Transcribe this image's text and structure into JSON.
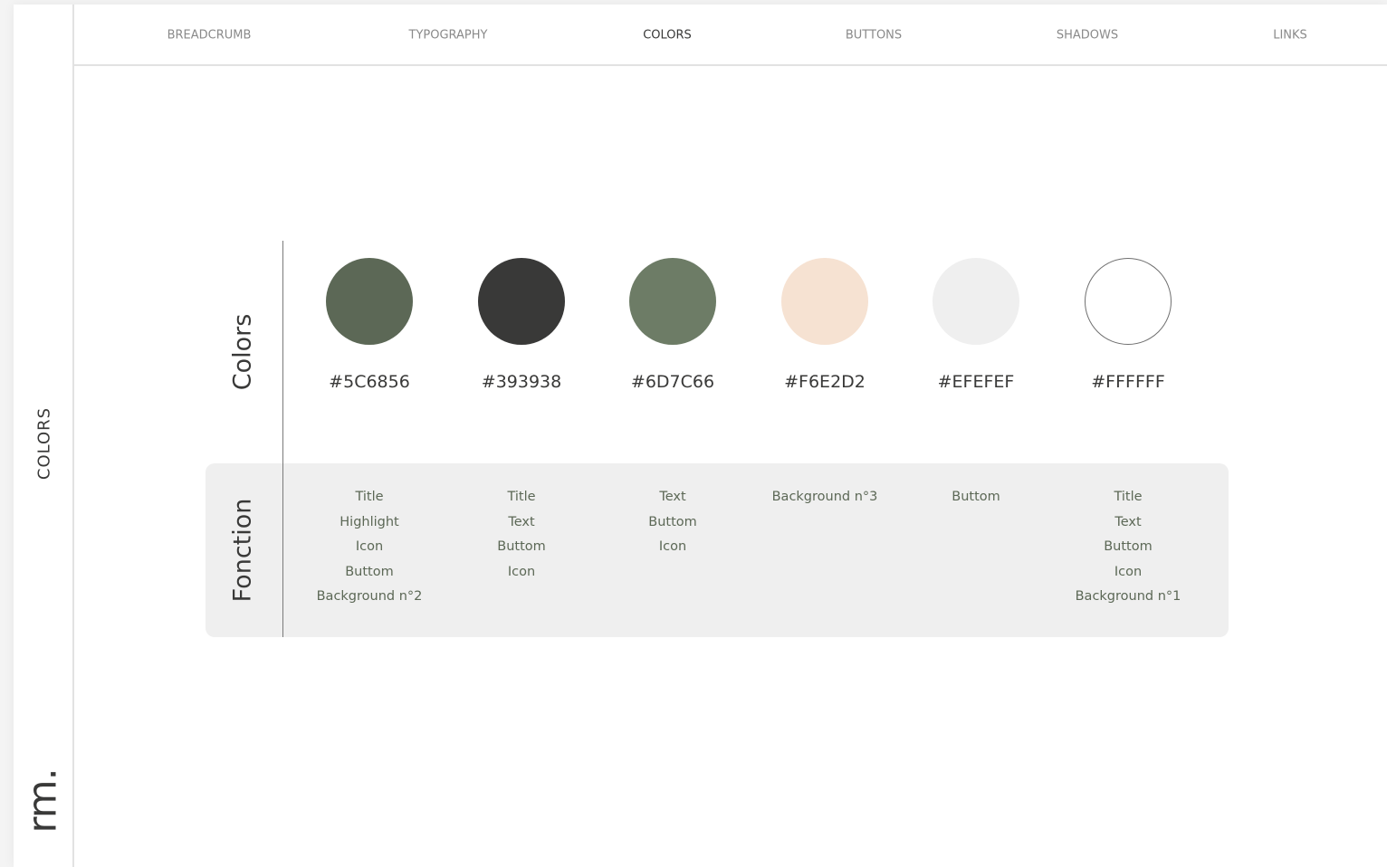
{
  "sidebar": {
    "section_label": "COLORS",
    "logo_text": "rm."
  },
  "nav": {
    "items": [
      {
        "label": "BREADCRUMB",
        "active": false
      },
      {
        "label": "TYPOGRAPHY",
        "active": false
      },
      {
        "label": "COLORS",
        "active": true
      },
      {
        "label": "BUTTONS",
        "active": false
      },
      {
        "label": "SHADOWS",
        "active": false
      },
      {
        "label": "LINKS",
        "active": false
      }
    ]
  },
  "colors_section": {
    "title": "Colors",
    "swatches": [
      {
        "hex": "#5C6856",
        "fill": "#5C6856"
      },
      {
        "hex": "#393938",
        "fill": "#393938"
      },
      {
        "hex": "#6D7C66",
        "fill": "#6D7C66"
      },
      {
        "hex": "#F6E2D2",
        "fill": "#F6E2D2"
      },
      {
        "hex": "#EFEFEF",
        "fill": "#EFEFEF"
      },
      {
        "hex": "#FFFFFF",
        "fill": "#FFFFFF"
      }
    ]
  },
  "function_section": {
    "title": "Fonction",
    "columns": [
      [
        "Title",
        "Highlight",
        "Icon",
        "Buttom",
        "Background n°2"
      ],
      [
        "Title",
        "Text",
        "Buttom",
        "Icon"
      ],
      [
        "Text",
        "Buttom",
        "Icon"
      ],
      [
        "Background n°3"
      ],
      [
        "Buttom"
      ],
      [
        "Title",
        "Text",
        "Buttom",
        "Icon",
        "Background n°1"
      ]
    ]
  },
  "theme": {
    "text_dark": "#393938",
    "text_green": "#5C6856",
    "nav_inactive": "#8A8A8A",
    "divider": "#E2E2E2",
    "panel_bg": "#EFEFEF"
  }
}
